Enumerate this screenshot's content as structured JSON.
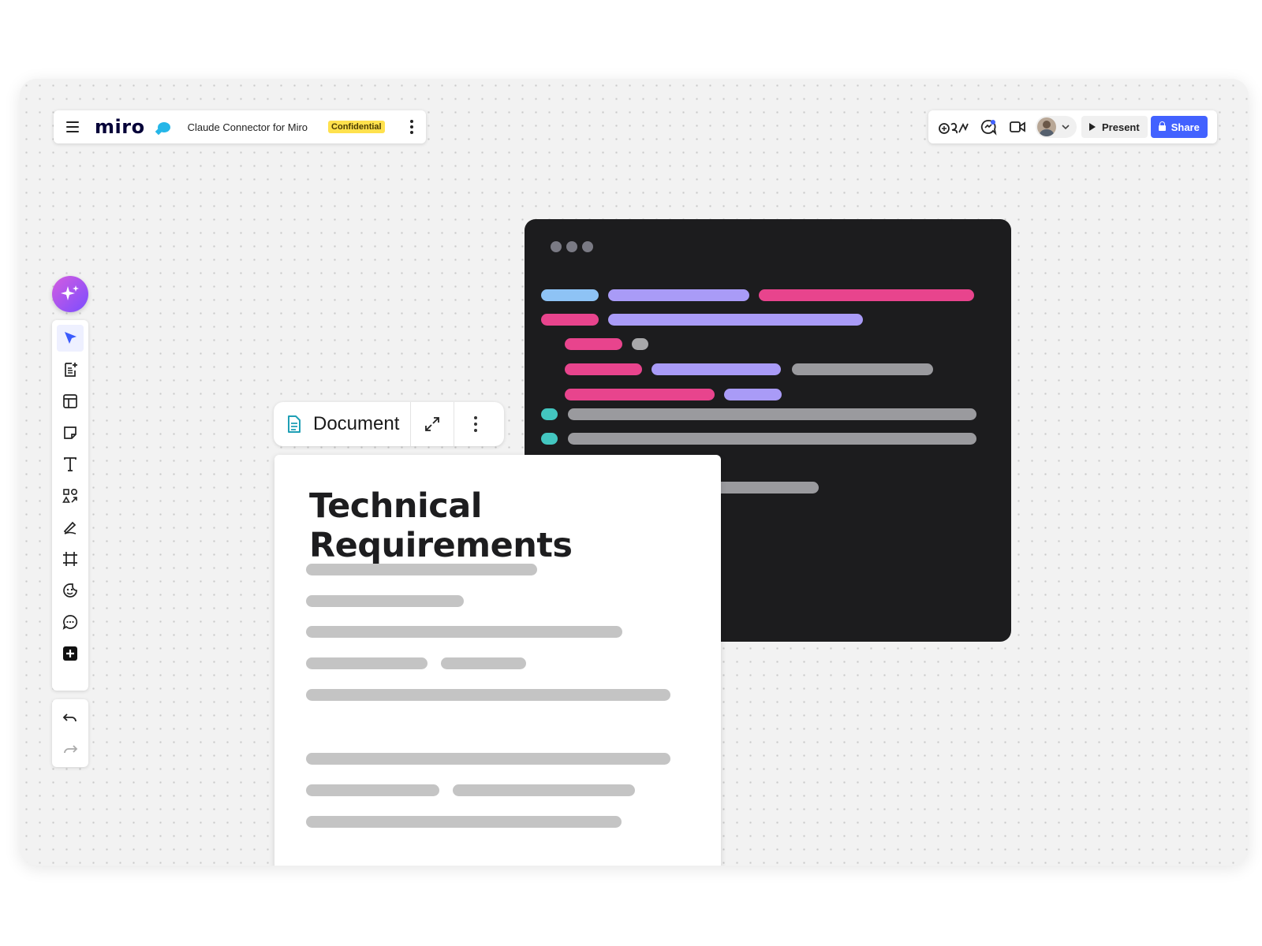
{
  "header": {
    "logo": "miro",
    "board_title": "Claude Connector for Miro",
    "badge": "Confidential"
  },
  "actions": {
    "present_label": "Present",
    "share_label": "Share"
  },
  "toolbar": {
    "tools": [
      "select-cursor",
      "doc-add",
      "templates",
      "sticky-note",
      "text",
      "shapes",
      "pen",
      "frame",
      "emoji-sticker",
      "comment",
      "more-add"
    ],
    "history": [
      "undo",
      "redo"
    ]
  },
  "document": {
    "toolbar_label": "Document",
    "title": "Technical Requirements"
  },
  "colors": {
    "accent": "#4262ff",
    "badge": "#ffe14d",
    "ai_gradient_start": "#d45ce0",
    "ai_gradient_end": "#7a4dff",
    "code_bg": "#1c1c1e",
    "code_pink": "#e8448d",
    "code_violet": "#a99bf7",
    "code_blue": "#8ec3f5",
    "code_teal": "#43c6c0"
  }
}
